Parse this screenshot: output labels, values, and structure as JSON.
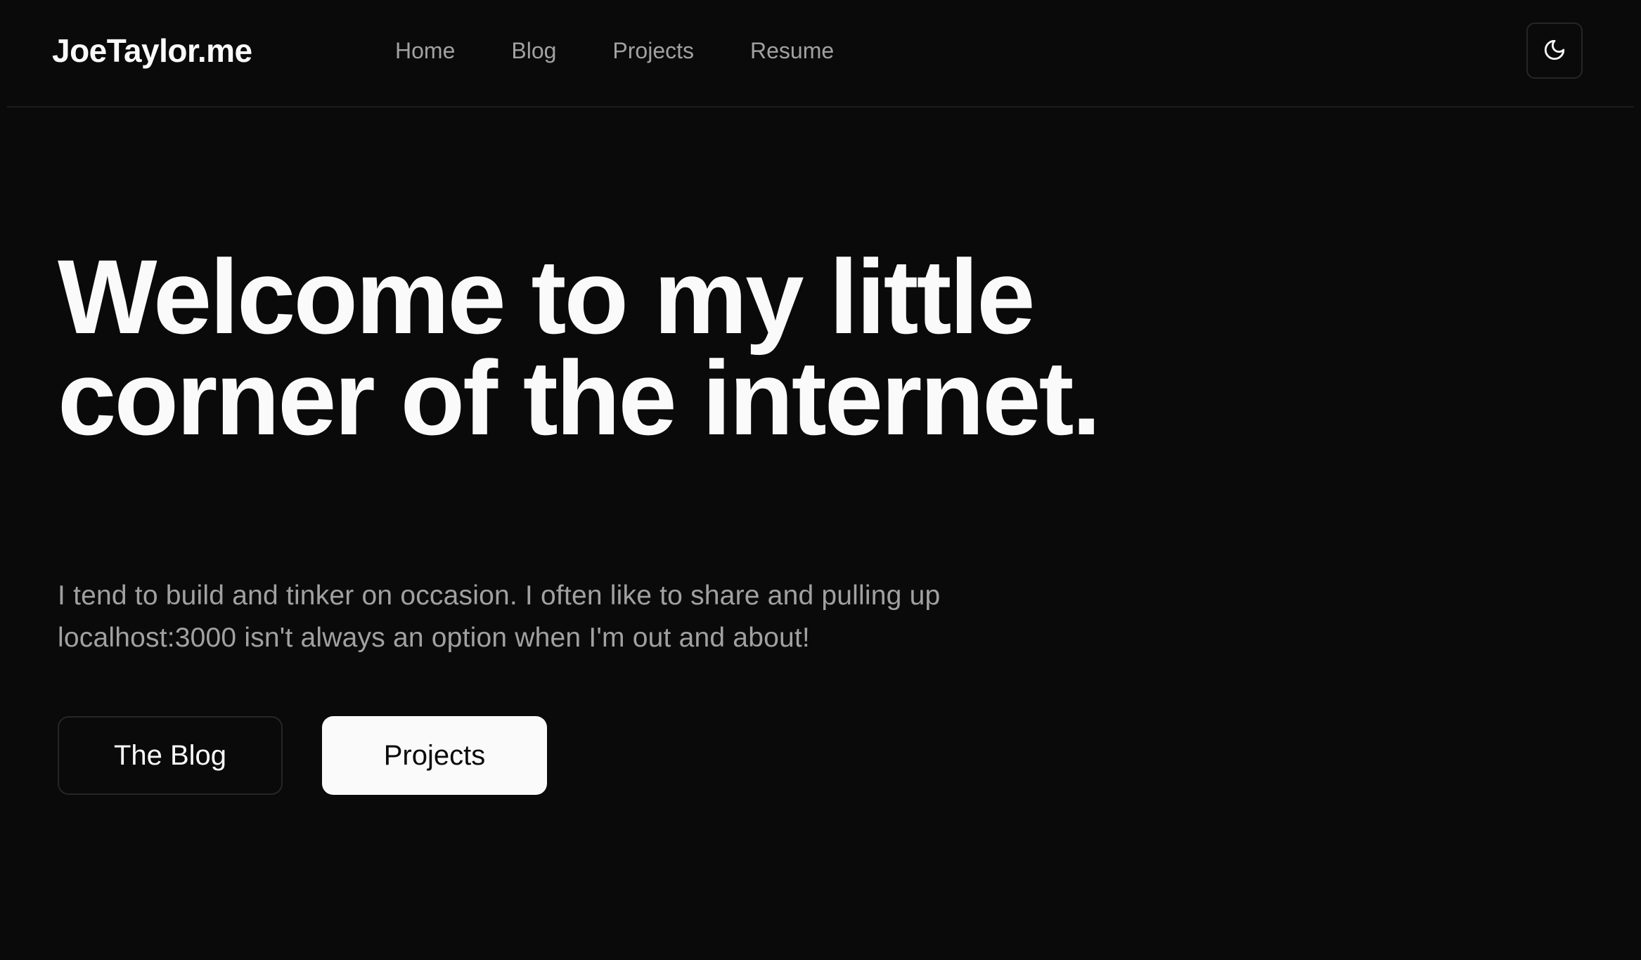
{
  "header": {
    "brand": "JoeTaylor.me",
    "nav": [
      {
        "label": "Home"
      },
      {
        "label": "Blog"
      },
      {
        "label": "Projects"
      },
      {
        "label": "Resume"
      }
    ],
    "theme_toggle_icon": "moon-icon"
  },
  "hero": {
    "title": "Welcome to my little corner of the internet.",
    "subtitle": "I tend to build and tinker on occasion. I often like to share and pulling up localhost:3000 isn't always an option when I'm out and about!",
    "buttons": {
      "blog": "The Blog",
      "projects": "Projects"
    }
  },
  "colors": {
    "background": "#0a0a0a",
    "text": "#fafafa",
    "muted": "#a1a1a1",
    "border": "#262626"
  }
}
